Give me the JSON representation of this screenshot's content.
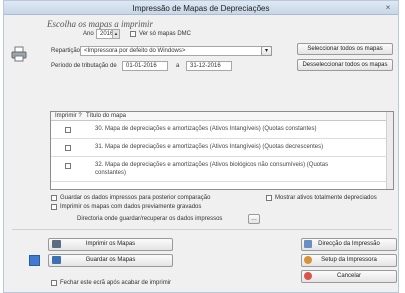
{
  "window": {
    "title": "Impressão de Mapas de Depreciações",
    "close_glyph": "×"
  },
  "heading": "Escolha os mapas a imprimir",
  "year": {
    "label": "Ano",
    "value": "2016",
    "not_issued_label": "Ver só mapas DMC"
  },
  "department": {
    "label": "Repartição",
    "value": "<Impressora por defeito do Windows>"
  },
  "buttons": {
    "select_all": "Seleccionar todos os mapas",
    "deselect_all": "Desseleccionar todos os mapas",
    "print_maps": "Imprimir os Mapas",
    "save_maps": "Guardar os Mapas",
    "print_direction": "Direcção da Impressão",
    "printer_setup": "Setup da Impressora",
    "cancel": "Cancelar"
  },
  "period": {
    "label": "Período de tributação de",
    "from": "01-01-2016",
    "to_label": "a",
    "to": "31-12-2016"
  },
  "grid": {
    "headers": [
      "Imprimir ?",
      "Título do mapa"
    ],
    "rows": [
      {
        "title": "30. Mapa de depreciações e amortizações (Ativos Intangíveis) (Quotas constantes)"
      },
      {
        "title": "31. Mapa de depreciações e amortizações (Ativos Intangíveis) (Quotas decrescentes)"
      },
      {
        "title": "32. Mapa de depreciações e amortizações (Ativos biológicos não consumíveis) (Quotas",
        "title2": "constantes)"
      }
    ]
  },
  "options": {
    "save_data": "Guardar os dados impressos para posterior comparação",
    "show_fully_depreciated": "Mostrar ativos totalmente depreciados",
    "print_without_data": "Imprimir os mapas com dados previamente gravados",
    "directory_label": "Directoria onde guardar/recuperar os dados impressos",
    "close_after_print": "Fechar este ecrã após acabar de imprimir"
  }
}
